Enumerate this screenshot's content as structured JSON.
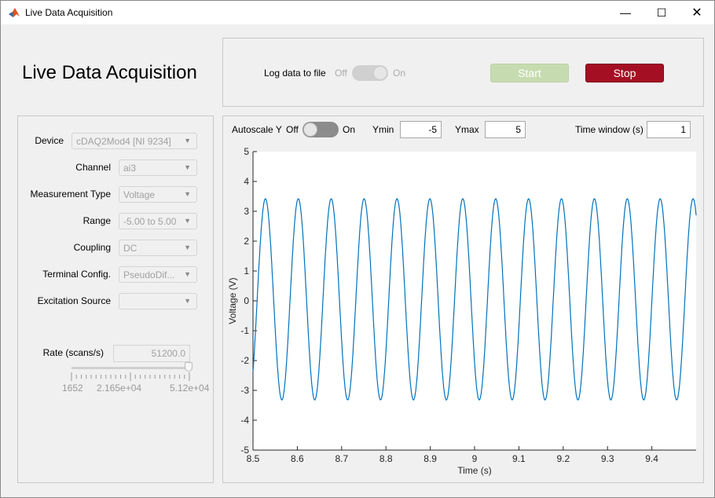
{
  "window": {
    "title": "Live Data Acquisition",
    "controls": [
      "minimize",
      "maximize",
      "close"
    ]
  },
  "header": {
    "title": "Live Data Acquisition"
  },
  "log": {
    "label": "Log data to file",
    "off": "Off",
    "on": "On",
    "state": "off",
    "enabled": false
  },
  "buttons": {
    "start": "Start",
    "stop": "Stop",
    "start_color": "#c6dcb0",
    "stop_color": "#a50f24"
  },
  "settings": [
    {
      "label": "Device",
      "value": "cDAQ2Mod4 [NI 9234]"
    },
    {
      "label": "Channel",
      "value": "ai3"
    },
    {
      "label": "Measurement Type",
      "value": "Voltage"
    },
    {
      "label": "Range",
      "value": "-5.00 to 5.00"
    },
    {
      "label": "Coupling",
      "value": "DC"
    },
    {
      "label": "Terminal Config.",
      "value": "PseudoDif..."
    },
    {
      "label": "Excitation Source",
      "value": ""
    }
  ],
  "rate": {
    "label": "Rate (scans/s)",
    "value": "51200.0",
    "slider_min": "1652",
    "slider_mid": "2.165e+04",
    "slider_max": "5.12e+04",
    "slider_value": 51200
  },
  "plot_controls": {
    "autoscale_label": "Autoscale Y",
    "off": "Off",
    "on": "On",
    "autoscale_state": "off",
    "ymin_label": "Ymin",
    "ymin": "-5",
    "ymax_label": "Ymax",
    "ymax": "5",
    "window_label": "Time window (s)",
    "window": "1"
  },
  "chart_data": {
    "type": "line",
    "xlabel": "Time (s)",
    "ylabel": "Voltage (V)",
    "xlim": [
      8.5,
      9.5
    ],
    "ylim": [
      -5,
      5
    ],
    "xticks": [
      "8.5",
      "8.6",
      "8.7",
      "8.8",
      "8.9",
      "9",
      "9.1",
      "9.2",
      "9.3",
      "9.4"
    ],
    "yticks": [
      "5",
      "4",
      "3",
      "2",
      "1",
      "0",
      "-1",
      "-2",
      "-3",
      "-4",
      "-5"
    ],
    "grid": false,
    "line_color": "#0072bd",
    "series": [
      {
        "shape": "sine",
        "frequency_hz": 13.47,
        "amplitude_v": 3.37,
        "offset_v": 0.05,
        "first_peak_time_s": 8.528,
        "t_start": 8.5,
        "t_end": 9.5
      }
    ]
  }
}
